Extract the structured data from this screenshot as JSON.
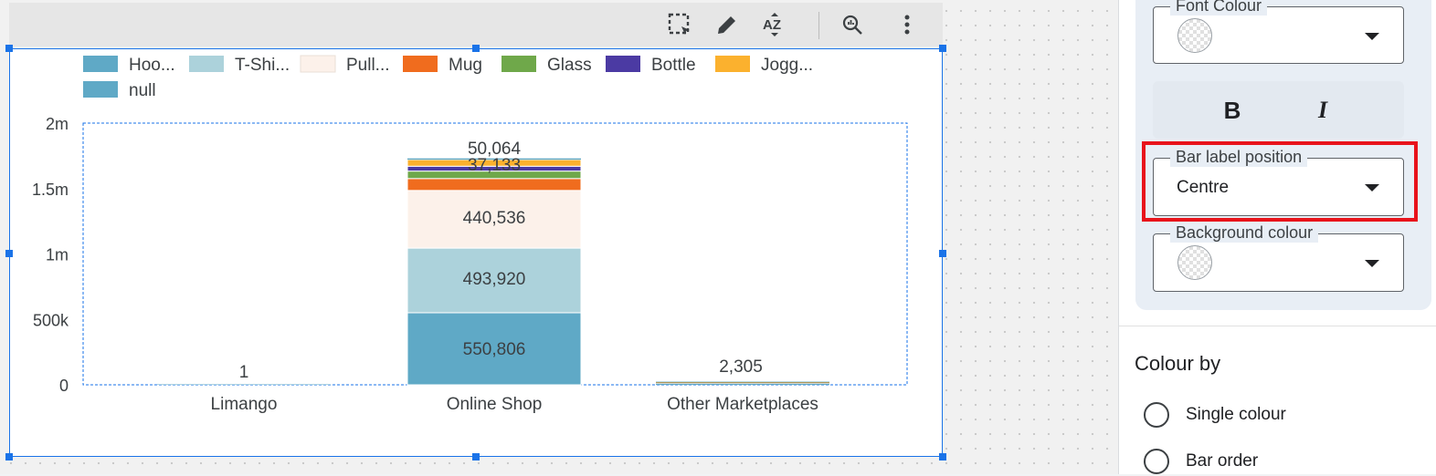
{
  "toolbar": {
    "icons": [
      "select-area-icon",
      "edit-pencil-icon",
      "sort-az-icon",
      "explore-icon",
      "more-vert-icon"
    ]
  },
  "chart_data": {
    "type": "bar",
    "stacked": true,
    "categories": [
      "Limango",
      "Online Shop",
      "Other Marketplaces"
    ],
    "legend": [
      "Hoo...",
      "T-Shi...",
      "Pull...",
      "Mug",
      "Glass",
      "Bottle",
      "Jogg...",
      "null"
    ],
    "colors": [
      "#5fa9c6",
      "#acd2db",
      "#fcf1ea",
      "#f06c1e",
      "#6fa84a",
      "#4b3aa3",
      "#fbb12e",
      "#5fa9c6"
    ],
    "series": [
      {
        "name": "Hoo...",
        "values": [
          1,
          550806,
          8000
        ]
      },
      {
        "name": "T-Shi...",
        "values": [
          0,
          493920,
          3000
        ]
      },
      {
        "name": "Pull...",
        "values": [
          0,
          440536,
          2305
        ]
      },
      {
        "name": "Mug",
        "values": [
          0,
          91000,
          2000
        ]
      },
      {
        "name": "Glass",
        "values": [
          0,
          57000,
          1500
        ]
      },
      {
        "name": "Bottle",
        "values": [
          0,
          37133,
          1200
        ]
      },
      {
        "name": "Jogg...",
        "values": [
          0,
          50064,
          2305
        ]
      },
      {
        "name": "null",
        "values": [
          0,
          10000,
          500
        ]
      }
    ],
    "data_labels": [
      {
        "category": "Limango",
        "text": "1"
      },
      {
        "category": "Online Shop",
        "text": "550,806"
      },
      {
        "category": "Online Shop",
        "text": "493,920"
      },
      {
        "category": "Online Shop",
        "text": "440,536"
      },
      {
        "category": "Online Shop",
        "text": "37,133"
      },
      {
        "category": "Online Shop",
        "text": "50,064"
      },
      {
        "category": "Other Marketplaces",
        "text": "2,305"
      }
    ],
    "yticks": [
      "0",
      "500k",
      "1m",
      "1.5m",
      "2m"
    ],
    "ytick_values": [
      0,
      500000,
      1000000,
      1500000,
      2000000
    ],
    "ylim": [
      0,
      2000000
    ],
    "legend_position": "top-left"
  },
  "panel": {
    "font_colour_label": "Font Colour",
    "bold_label": "B",
    "italic_label": "I",
    "bar_label_position_label": "Bar label position",
    "bar_label_position_value": "Centre",
    "background_colour_label": "Background colour",
    "colour_by_title": "Colour by",
    "colour_by_options": [
      "Single colour",
      "Bar order"
    ]
  },
  "colors": {
    "selection": "#1a73e8",
    "highlight": "#e8131b"
  }
}
